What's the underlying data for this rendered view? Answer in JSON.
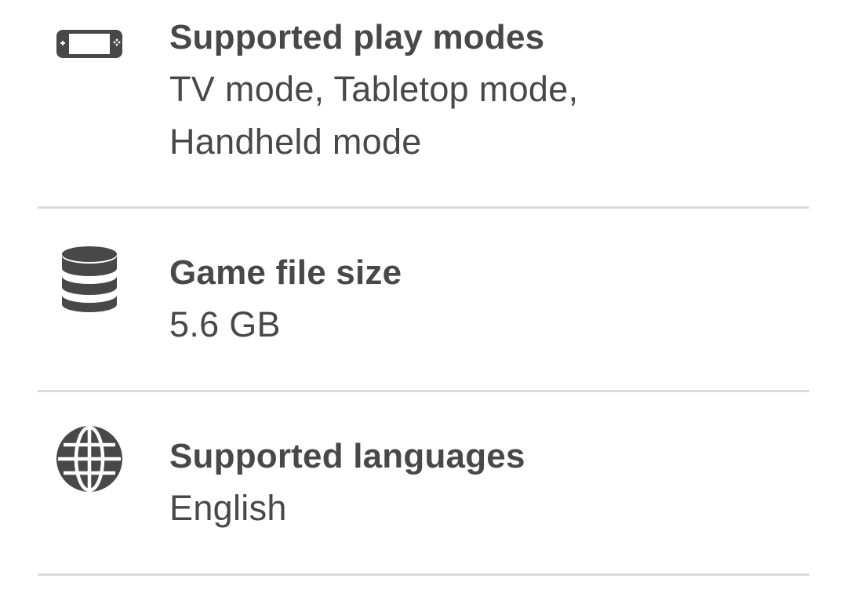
{
  "details": {
    "play_modes": {
      "icon": "handheld-console-icon",
      "title": "Supported play modes",
      "value_line_1": "TV mode, Tabletop mode,",
      "value_line_2": "Handheld mode"
    },
    "file_size": {
      "icon": "database-icon",
      "title": "Game file size",
      "value": "5.6 GB"
    },
    "languages": {
      "icon": "globe-icon",
      "title": "Supported languages",
      "value": "English"
    }
  },
  "colors": {
    "text": "#484848",
    "divider": "#dcdcdc",
    "background": "#ffffff"
  }
}
